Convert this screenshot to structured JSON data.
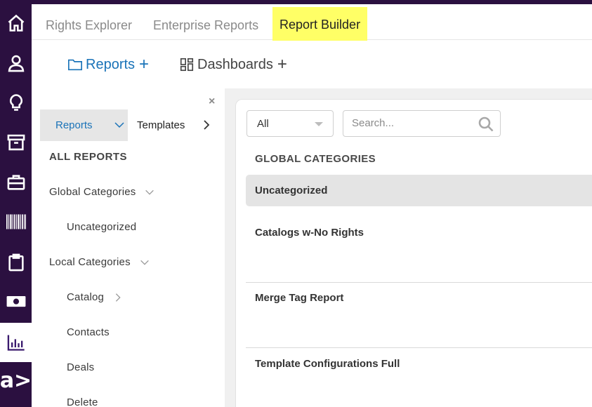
{
  "rail": {
    "icons": [
      "home-icon",
      "user-icon",
      "lightbulb-icon",
      "archive-icon",
      "briefcase-icon",
      "barcode-icon",
      "clipboard-icon",
      "money-icon",
      "chart-icon"
    ],
    "logo": "a>"
  },
  "topnav": {
    "tabs": [
      {
        "label": "Rights Explorer"
      },
      {
        "label": "Enterprise Reports"
      },
      {
        "label": "Report Builder"
      }
    ]
  },
  "subbar": {
    "reports_label": "Reports",
    "dashboards_label": "Dashboards",
    "plus": "+"
  },
  "leftpanel": {
    "close": "×",
    "segment_label": "Reports",
    "templates_label": "Templates",
    "tree": {
      "all_reports": "ALL REPORTS",
      "global_categories": "Global Categories",
      "uncategorized": "Uncategorized",
      "local_categories": "Local Categories",
      "catalog": "Catalog",
      "contacts": "Contacts",
      "deals": "Deals",
      "delete": "Delete"
    }
  },
  "main": {
    "filter_value": "All",
    "search_placeholder": "Search...",
    "section_title": "GLOBAL CATEGORIES",
    "selected_category": "Uncategorized",
    "reports": [
      "Catalogs w-No Rights",
      "Merge Tag Report",
      "Template Configurations Full"
    ]
  },
  "colors": {
    "rail": "#2b1040",
    "highlight": "#ffff66",
    "link_blue": "#1a73b8"
  }
}
